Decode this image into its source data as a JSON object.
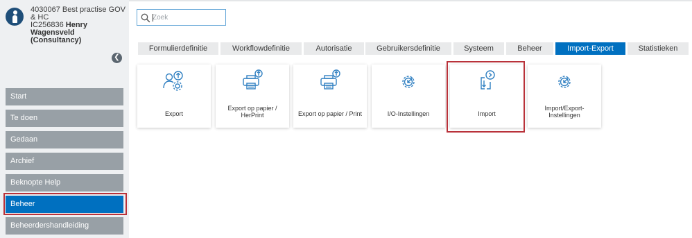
{
  "account": {
    "org_line1": "4030067 Best practise GOV",
    "org_line2": "& HC",
    "user_id": "IC256836",
    "user_name": "Henry Wagensveld (Consultancy)"
  },
  "search": {
    "placeholder": "Zoek",
    "value": ""
  },
  "sidebar": {
    "items": [
      {
        "label": "Start"
      },
      {
        "label": "Te doen"
      },
      {
        "label": "Gedaan"
      },
      {
        "label": "Archief"
      },
      {
        "label": "Beknopte Help"
      },
      {
        "label": "Beheer",
        "active": true
      },
      {
        "label": "Beheerdershandleiding"
      }
    ]
  },
  "tabs": [
    {
      "label": "Formulierdefinitie"
    },
    {
      "label": "Workflowdefinitie"
    },
    {
      "label": "Autorisatie"
    },
    {
      "label": "Gebruikersdefinitie"
    },
    {
      "label": "Systeem"
    },
    {
      "label": "Beheer"
    },
    {
      "label": "Import-Export",
      "active": true
    },
    {
      "label": "Statistieken"
    }
  ],
  "tiles": [
    {
      "label": "Export",
      "icon": "user-export-icon"
    },
    {
      "label": "Export op papier / HerPrint",
      "icon": "printer-export-icon"
    },
    {
      "label": "Export op papier / Print",
      "icon": "printer-export-icon"
    },
    {
      "label": "I/O-Instellingen",
      "icon": "gear-arrow-icon"
    },
    {
      "label": "Import",
      "icon": "import-icon"
    },
    {
      "label": "Import/Export-Instellingen",
      "icon": "gear-arrow-icon"
    }
  ],
  "colors": {
    "accent": "#0070c0",
    "sidebar_item": "#98a0a6",
    "highlight": "#b9323a",
    "icon": "#2f7fc1"
  }
}
